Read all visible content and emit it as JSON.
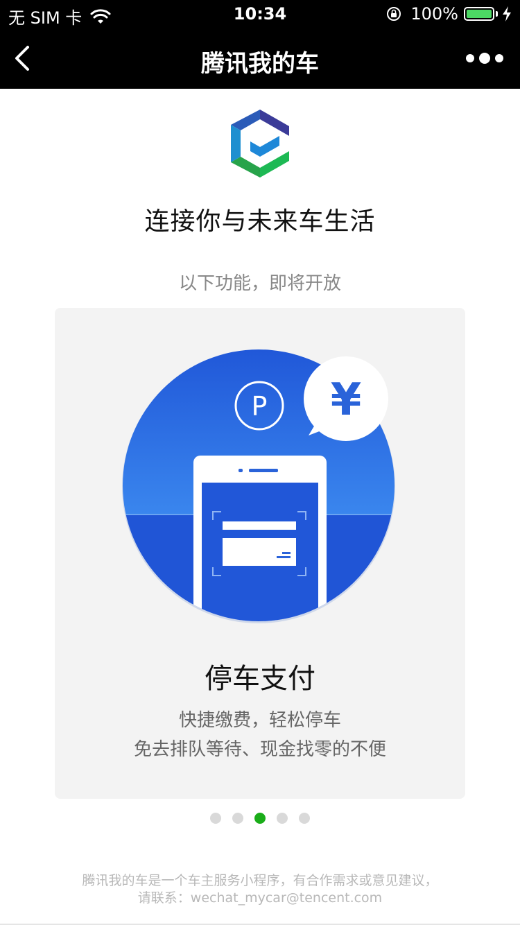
{
  "status_bar": {
    "carrier": "无 SIM 卡",
    "time": "10:34",
    "battery_percent": "100%",
    "battery_level": 1.0,
    "battery_color": "#4cd964"
  },
  "nav": {
    "title": "腾讯我的车",
    "back_icon": "chevron-left-icon",
    "more_icon": "more-dots-icon"
  },
  "hero": {
    "logo_icon": "tencent-mycar-logo",
    "headline": "连接你与未来车生活",
    "subhead": "以下功能，即将开放"
  },
  "feature_card": {
    "illustration_icon": "parking-payment-illustration",
    "parking_symbol": "P",
    "currency_symbol": "¥",
    "title": "停车支付",
    "desc_line1": "快捷缴费，轻松停车",
    "desc_line2": "免去排队等待、现金找零的不便",
    "accent_color": "#2a63d9"
  },
  "carousel": {
    "page_count": 5,
    "active_page": 3,
    "active_color": "#1aad19"
  },
  "footer": {
    "line1": "腾讯我的车是一个车主服务小程序，有合作需求或意见建议，",
    "line2": "请联系：wechat_mycar@tencent.com"
  }
}
